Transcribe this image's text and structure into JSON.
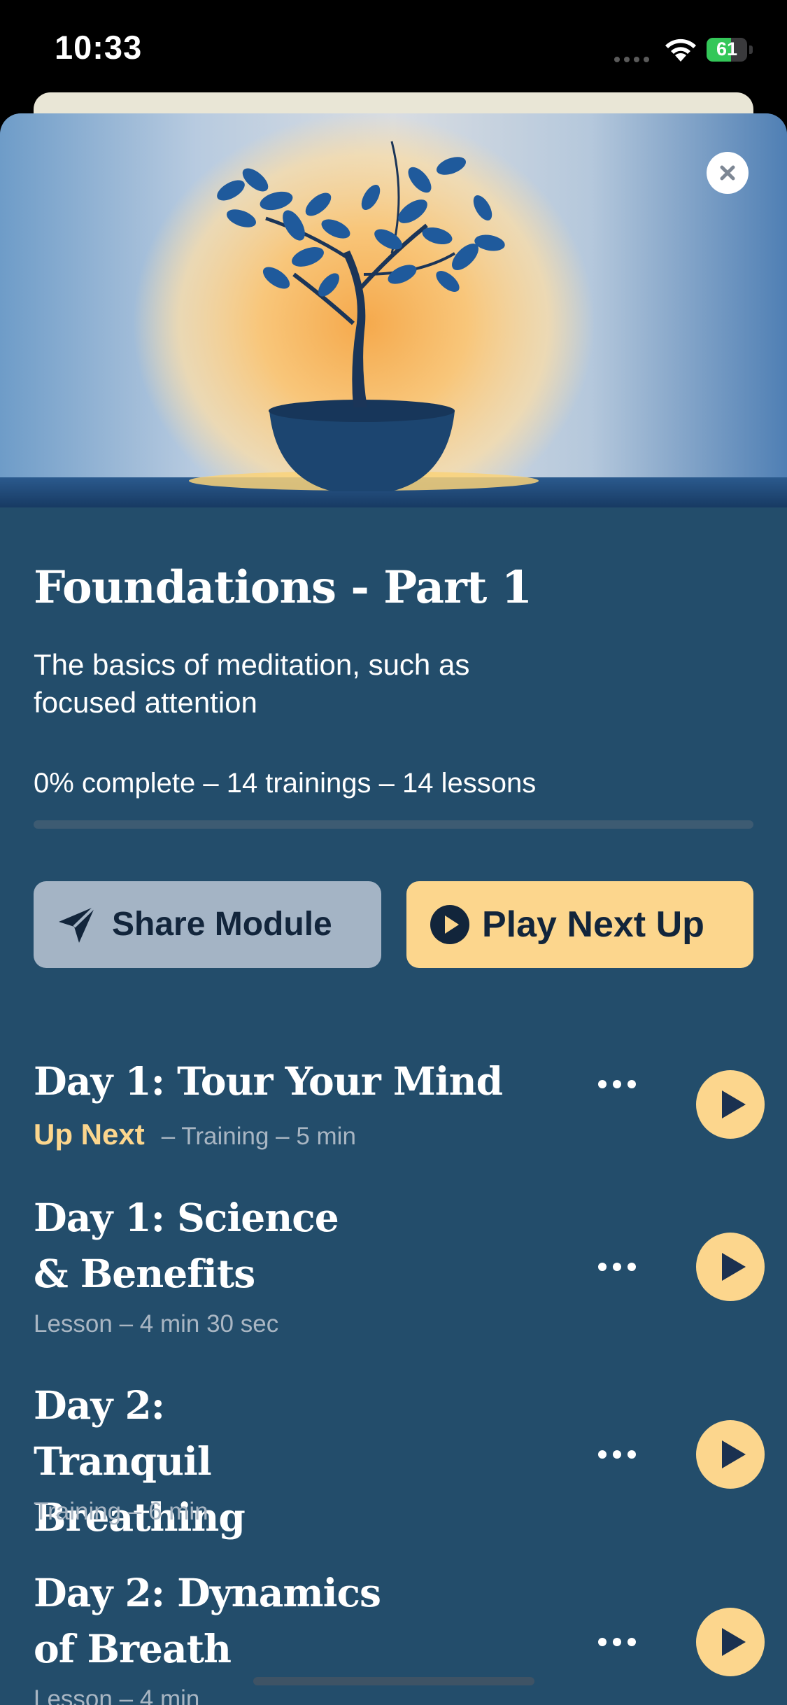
{
  "status_bar": {
    "time": "10:33",
    "battery": "61",
    "battery_fraction": 0.61
  },
  "module": {
    "title": "Foundations - Part 1",
    "description": "The basics of meditation, such as focused attention",
    "meta": "0% complete – 14 trainings – 14 lessons",
    "progress_fraction": 0.0
  },
  "buttons": {
    "share_label": "Share Module",
    "play_label": "Play Next Up"
  },
  "items": [
    {
      "title": "Day 1: Tour Your Mind",
      "badge": "Up Next",
      "subtitle": "– Training – 5 min"
    },
    {
      "title": "Day 1: Science & Benefits",
      "badge": "",
      "subtitle": "Lesson – 4 min 30 sec"
    },
    {
      "title": "Day 2: Tranquil Breathing",
      "badge": "",
      "subtitle": "Training – 6 min"
    },
    {
      "title": "Day 2: Dynamics of Breath",
      "badge": "",
      "subtitle": "Lesson – 4 min"
    }
  ],
  "colors": {
    "sheet_bg": "#234d6b",
    "accent": "#fcd68d",
    "share_bg": "#a4b4c5"
  },
  "icons": {
    "close": "close-icon",
    "share": "paper-plane-icon",
    "play": "play-icon",
    "more": "more-dots-icon"
  }
}
